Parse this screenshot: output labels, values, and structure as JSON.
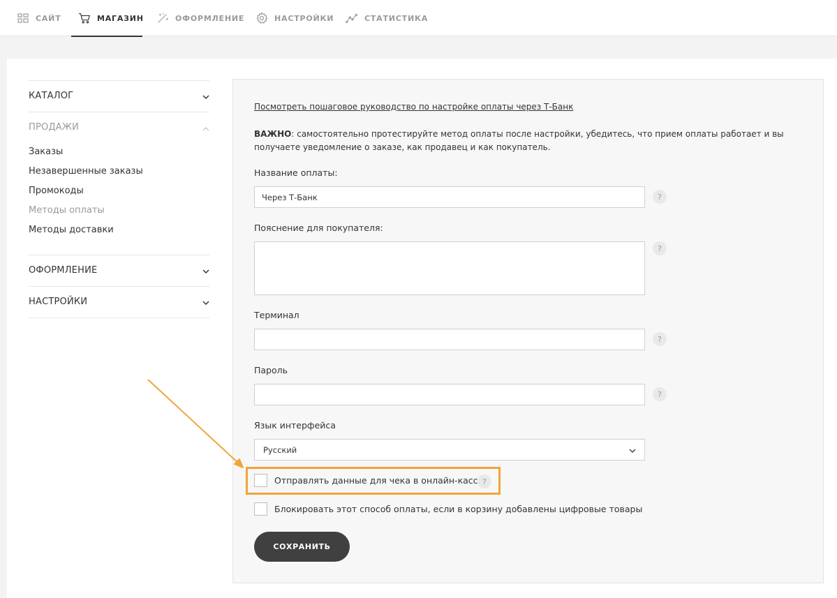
{
  "nav": {
    "tabs": [
      {
        "label": "САЙТ",
        "icon": "grid-icon"
      },
      {
        "label": "МАГАЗИН",
        "icon": "cart-icon"
      },
      {
        "label": "ОФОРМЛЕНИЕ",
        "icon": "magic-wand-icon"
      },
      {
        "label": "НАСТРОЙКИ",
        "icon": "gear-icon"
      },
      {
        "label": "СТАТИСТИКА",
        "icon": "line-chart-icon"
      }
    ],
    "active": "МАГАЗИН"
  },
  "sidebar": {
    "catalog": "КАТАЛОГ",
    "sales": "ПРОДАЖИ",
    "sales_items": [
      "Заказы",
      "Незавершенные заказы",
      "Промокоды",
      "Методы оплаты",
      "Методы доставки"
    ],
    "sales_current": "Методы оплаты",
    "design": "ОФОРМЛЕНИЕ",
    "settings": "НАСТРОЙКИ"
  },
  "form": {
    "guide_link": "Посмотреть пошаговое руководство по настройке оплаты через Т-Банк",
    "important_label": "ВАЖНО",
    "important_text": ": самостоятельно протестируйте метод оплаты после настройки, убедитесь, что прием оплаты работает и вы получаете уведомление о заказе, как продавец и как покупатель.",
    "payment_name_label": "Название оплаты:",
    "payment_name_value": "Через Т-Банк",
    "buyer_note_label": "Пояснение для покупателя:",
    "buyer_note_value": "",
    "terminal_label": "Терминал",
    "terminal_value": "",
    "password_label": "Пароль",
    "password_value": "",
    "language_label": "Язык интерфейса",
    "language_value": "Русский",
    "checkbox_receipt": "Отправлять данные для чека в онлайн-кассу",
    "checkbox_block": "Блокировать этот способ оплаты, если в корзину добавлены цифровые товары",
    "help_glyph": "?",
    "save_label": "СОХРАНИТЬ"
  },
  "colors": {
    "highlight": "#f0a53a",
    "button": "#404040"
  }
}
